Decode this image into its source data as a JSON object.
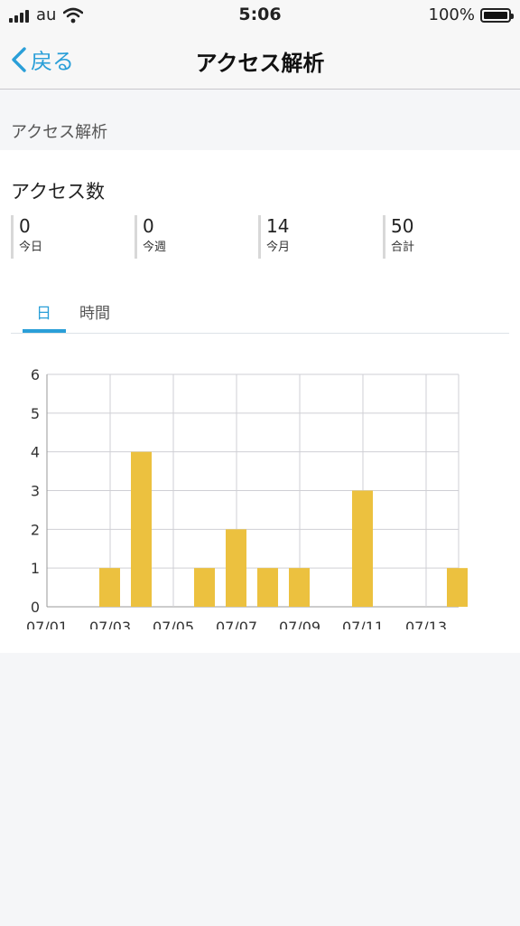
{
  "status_bar": {
    "carrier": "au",
    "time": "5:06",
    "battery_percent": "100%",
    "icons": [
      "signal-icon",
      "wifi-icon",
      "battery-icon"
    ]
  },
  "nav": {
    "back_label": "戻る",
    "title": "アクセス解析",
    "accent_color": "#2a9fd8"
  },
  "section_label": "アクセス解析",
  "card": {
    "title": "アクセス数",
    "stats": [
      {
        "value": "0",
        "label": "今日"
      },
      {
        "value": "0",
        "label": "今週"
      },
      {
        "value": "14",
        "label": "今月"
      },
      {
        "value": "50",
        "label": "合計"
      }
    ],
    "tabs": [
      {
        "label": "日",
        "active": true
      },
      {
        "label": "時間",
        "active": false
      }
    ]
  },
  "chart_data": {
    "type": "bar",
    "categories": [
      "07/01",
      "07/02",
      "07/03",
      "07/04",
      "07/05",
      "07/06",
      "07/07",
      "07/08",
      "07/09",
      "07/10",
      "07/11",
      "07/12",
      "07/13",
      "07/14"
    ],
    "values": [
      0,
      0,
      1,
      4,
      0,
      1,
      2,
      1,
      1,
      0,
      3,
      0,
      0,
      1
    ],
    "x_tick_labels": [
      "07/01",
      "07/03",
      "07/05",
      "07/07",
      "07/09",
      "07/11",
      "07/13"
    ],
    "y_ticks": [
      "0",
      "1",
      "2",
      "3",
      "4",
      "5",
      "6"
    ],
    "ylim": [
      0,
      6
    ],
    "grid": true,
    "bar_color": "#ecc13f"
  }
}
